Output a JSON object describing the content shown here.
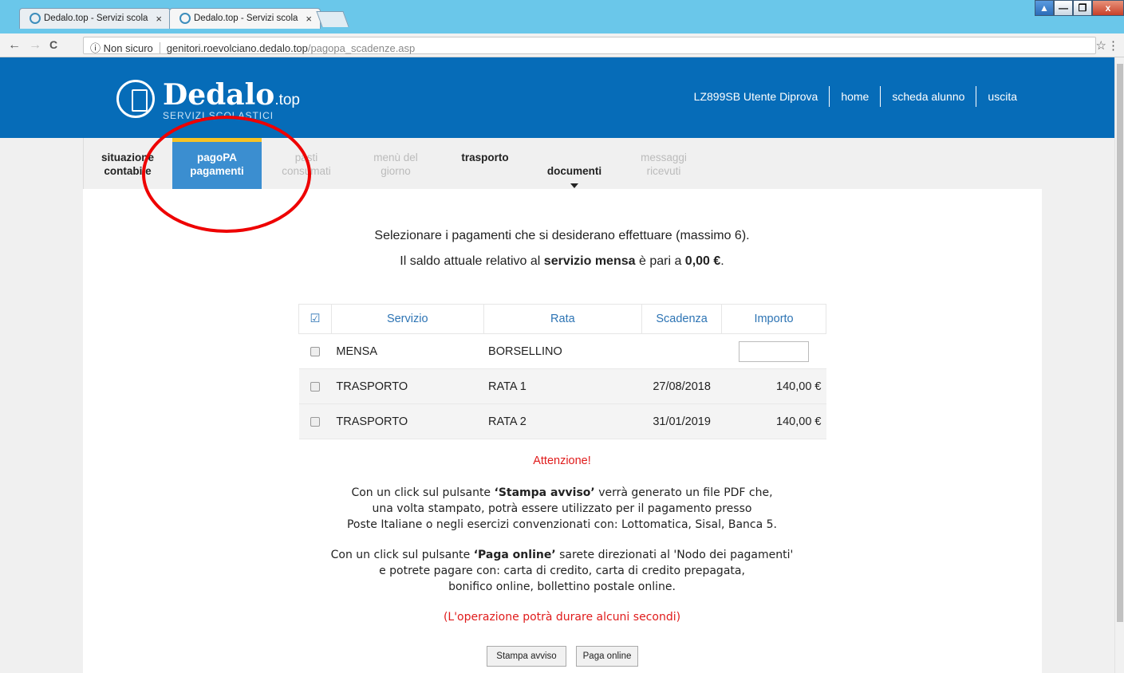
{
  "browser": {
    "tabs": [
      {
        "title": "Dedalo.top - Servizi scola"
      },
      {
        "title": "Dedalo.top - Servizi scola"
      }
    ],
    "tab_close": "×",
    "nav": {
      "back": "←",
      "forward": "→",
      "reload": "C"
    },
    "security": "ⓘ Non sicuro",
    "url_host": "genitori.roevolciano.dedalo.top",
    "url_path": "/pagopa_scadenze.asp",
    "star": "☆",
    "menu": "⋮",
    "win_user": "▲",
    "win_min": "—",
    "win_max": "❐",
    "win_close": "x"
  },
  "header": {
    "logo_text": "Dedalo",
    "logo_tld": ".top",
    "logo_sub": "SERVIZI SCOLASTICI",
    "nav": [
      "LZ899SB Utente Diprova",
      "home",
      "scheda alunno",
      "uscita"
    ]
  },
  "menu": {
    "items": [
      {
        "label": "situazione\ncontabile"
      },
      {
        "label": "pagoPA\npagamenti"
      },
      {
        "label": "pasti\nconsumati"
      },
      {
        "label": "menù del\ngiorno"
      },
      {
        "label": "trasporto"
      },
      {
        "label": "documenti"
      },
      {
        "label": "messaggi\nricevuti"
      }
    ]
  },
  "main": {
    "intro1": "Selezionare i pagamenti che si desiderano effettuare (massimo 6).",
    "intro2_pre": "Il saldo attuale relativo al ",
    "intro2_service": "servizio mensa",
    "intro2_mid": " è pari a ",
    "intro2_amount": "0,00 €",
    "intro2_post": ".",
    "table": {
      "headers": [
        "Servizio",
        "Rata",
        "Scadenza",
        "Importo"
      ],
      "header_check": "☑",
      "rows": [
        {
          "servizio": "MENSA",
          "rata": "BORSELLINO",
          "scadenza": "",
          "importo": ""
        },
        {
          "servizio": "TRASPORTO",
          "rata": "RATA 1",
          "scadenza": "27/08/2018",
          "importo": "140,00 €"
        },
        {
          "servizio": "TRASPORTO",
          "rata": "RATA 2",
          "scadenza": "31/01/2019",
          "importo": "140,00 €"
        }
      ]
    },
    "attention": "Attenzione!",
    "p1_pre": "Con un click sul pulsante ",
    "p1_btn": "‘Stampa avviso’",
    "p1_post": " verrà generato un file PDF che,",
    "p1_l2": "una volta stampato, potrà essere utilizzato per il pagamento presso",
    "p1_l3": "Poste Italiane o negli esercizi convenzionati con: Lottomatica, Sisal, Banca 5.",
    "p2_pre": "Con un click sul pulsante ",
    "p2_btn": "‘Paga online’",
    "p2_post": " sarete direzionati al 'Nodo dei pagamenti'",
    "p2_l2": "e potrete pagare con: carta di credito, carta di credito prepagata,",
    "p2_l3": "bonifico online, bollettino postale online.",
    "note": "(L'operazione potrà durare alcuni secondi)",
    "btn_print": "Stampa avviso",
    "btn_pay": "Paga online"
  },
  "colors": {
    "header_blue": "#066cb8",
    "active_tab": "#3b8ed0",
    "active_border": "#f7c325",
    "table_header": "#2d74b4",
    "warning_red": "#e01b1b",
    "annotation_red": "#e00000"
  }
}
